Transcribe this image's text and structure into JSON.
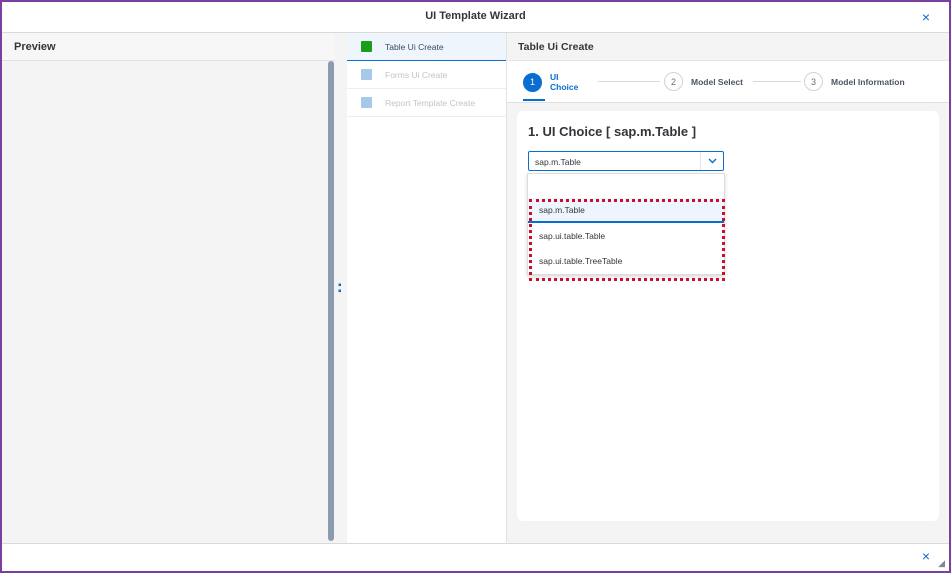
{
  "dialog": {
    "title": "UI Template Wizard",
    "close_icon": "×"
  },
  "preview": {
    "title": "Preview"
  },
  "nav": {
    "items": [
      {
        "label": "Table Ui Create"
      },
      {
        "label": "Forms Ui Create"
      },
      {
        "label": "Report Template Create"
      }
    ]
  },
  "main": {
    "title": "Table Ui Create",
    "steps": [
      {
        "number": "1",
        "label": "UI Choice"
      },
      {
        "number": "2",
        "label": "Model Select"
      },
      {
        "number": "3",
        "label": "Model Information"
      }
    ],
    "heading": "1. UI Choice [ sap.m.Table ]",
    "select": {
      "value": "sap.m.Table",
      "options": [
        "sap.m.Table",
        "sap.ui.table.Table",
        "sap.ui.table.TreeTable"
      ]
    }
  },
  "footer": {
    "close_icon": "×"
  },
  "colors": {
    "accent": "#0a6ed1",
    "frame": "#7b3fa0",
    "highlight": "#c8102e",
    "active_square": "#1a9e1a"
  }
}
